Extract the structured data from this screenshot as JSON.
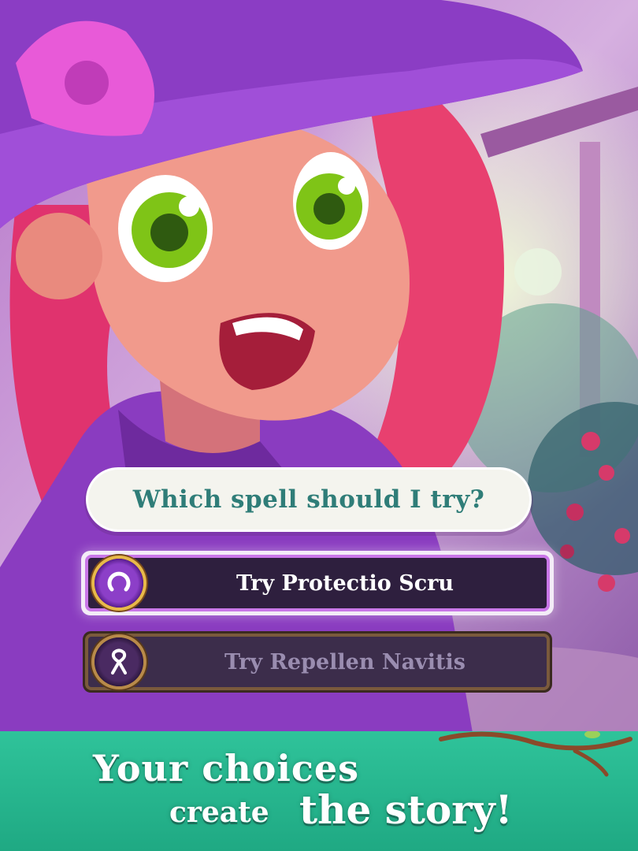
{
  "question": "Which spell should I try?",
  "choices": [
    {
      "label": "Try Protectio Scru",
      "icon": "spell-ring-icon",
      "state": "highlighted"
    },
    {
      "label": "Try Repellen Navitis",
      "icon": "spell-ribbon-icon",
      "state": "dimmed"
    }
  ],
  "tagline": {
    "line1": "Your choices",
    "line2a": "create",
    "line2b": "the story!"
  },
  "colors": {
    "footer": "#2fc39a",
    "question_text": "#2f7d78",
    "highlight_border": "#c977e8",
    "badge_gold": "#e8b94a"
  }
}
